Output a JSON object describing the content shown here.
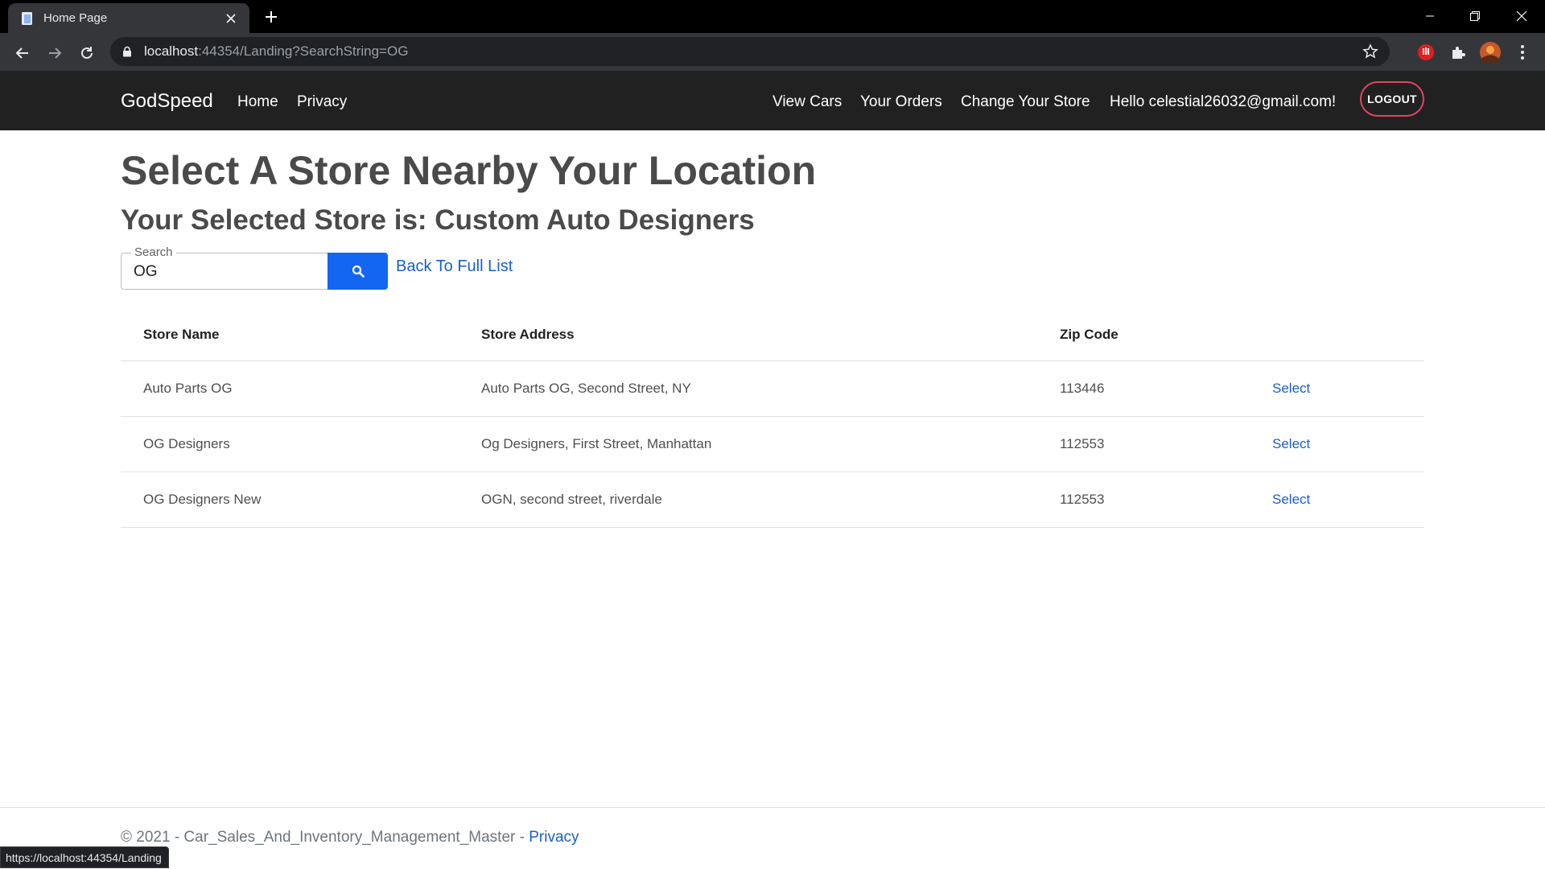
{
  "browser": {
    "tab_title": "Home Page",
    "url_host": "localhost",
    "url_path": ":44354/Landing?SearchString=OG",
    "status_url": "https://localhost:44354/Landing"
  },
  "navbar": {
    "brand": "GodSpeed",
    "left_links": [
      "Home",
      "Privacy"
    ],
    "right_links": [
      "View Cars",
      "Your Orders",
      "Change Your Store"
    ],
    "greeting": "Hello celestial26032@gmail.com!",
    "logout_label": "LOGOUT"
  },
  "page": {
    "title": "Select A Store Nearby Your Location",
    "subtitle": "Your Selected Store is: Custom Auto Designers"
  },
  "search": {
    "label": "Search",
    "value": "OG",
    "back_link": "Back To Full List"
  },
  "table": {
    "headers": [
      "Store Name",
      "Store Address",
      "Zip Code",
      ""
    ],
    "rows": [
      {
        "name": "Auto Parts OG",
        "address": "Auto Parts OG, Second Street, NY",
        "zip": "113446",
        "action": "Select"
      },
      {
        "name": "OG Designers",
        "address": "Og Designers, First Street, Manhattan",
        "zip": "112553",
        "action": "Select"
      },
      {
        "name": "OG Designers New",
        "address": "OGN, second street, riverdale",
        "zip": "112553",
        "action": "Select"
      }
    ]
  },
  "footer": {
    "text": "© 2021 - Car_Sales_And_Inventory_Management_Master - ",
    "link": "Privacy"
  },
  "colors": {
    "navbar_bg": "#212121",
    "primary": "#1266f1",
    "link": "#1a5fc9",
    "logout_border": "#e3445f"
  },
  "icons": {
    "search_button": "search-icon",
    "tab_favicon": "page-icon",
    "omnibox": "lock-icon"
  }
}
